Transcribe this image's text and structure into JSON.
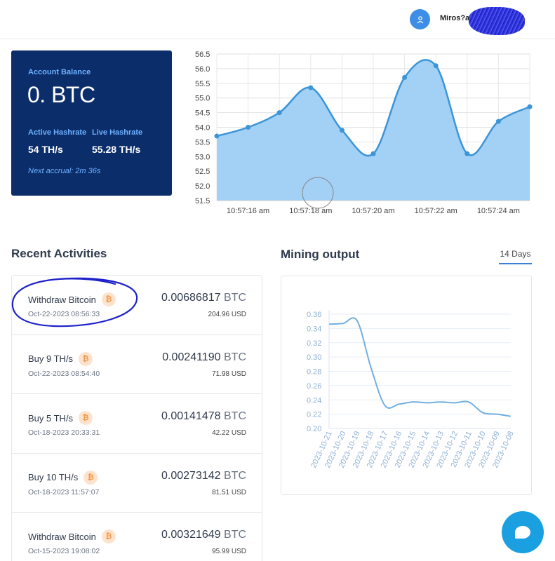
{
  "header": {
    "username": "Miros?a",
    "caret": "⌄"
  },
  "balance": {
    "label": "Account Balance",
    "amount": "0. BTC",
    "active_label": "Active Hashrate",
    "live_label": "Live Hashrate",
    "active_value": "54 TH/s",
    "live_value": "55.28 TH/s",
    "accrual": "Next accrual: 2m 36s"
  },
  "sections": {
    "recent_title": "Recent Activities",
    "mining_title": "Mining output",
    "tab_label": "14 Days"
  },
  "activities": [
    {
      "title": "Withdraw Bitcoin",
      "date": "Oct-22-2023 08:56:33",
      "amount": "0.00686817",
      "currency": "BTC",
      "usd": "204.96 USD"
    },
    {
      "title": "Buy 9 TH/s",
      "date": "Oct-22-2023 08:54:40",
      "amount": "0.00241190",
      "currency": "BTC",
      "usd": "71.98 USD"
    },
    {
      "title": "Buy 5 TH/s",
      "date": "Oct-18-2023 20:33:31",
      "amount": "0.00141478",
      "currency": "BTC",
      "usd": "42.22 USD"
    },
    {
      "title": "Buy 10 TH/s",
      "date": "Oct-18-2023 11:57:07",
      "amount": "0.00273142",
      "currency": "BTC",
      "usd": "81.51 USD"
    },
    {
      "title": "Withdraw Bitcoin",
      "date": "Oct-15-2023 19:08:02",
      "amount": "0.00321649",
      "currency": "BTC",
      "usd": "95.99 USD"
    }
  ],
  "btc_glyph": "₿",
  "colors": {
    "card_bg": "#0b2e6b",
    "accent": "#3d8ee6",
    "chart_fill": "#a3d0f5",
    "chart_line": "#3b95d8",
    "annotation": "#1e22c8"
  },
  "chart_data": [
    {
      "type": "area",
      "x": [
        "10:57:15 am",
        "10:57:16 am",
        "10:57:17 am",
        "10:57:18 am",
        "10:57:19 am",
        "10:57:20 am",
        "10:57:21 am",
        "10:57:22 am",
        "10:57:23 am",
        "10:57:24 am",
        "10:57:25 am"
      ],
      "values": [
        53.7,
        54.0,
        54.5,
        55.35,
        53.9,
        53.1,
        55.7,
        56.1,
        53.1,
        54.2,
        54.7
      ],
      "ylim": [
        51.5,
        56.5
      ],
      "yticks": [
        "51.5",
        "52.0",
        "52.5",
        "53.0",
        "53.5",
        "54.0",
        "54.5",
        "55.0",
        "55.5",
        "56.0",
        "56.5"
      ],
      "xtick_labels": [
        "10:57:16 am",
        "10:57:18 am",
        "10:57:20 am",
        "10:57:22 am",
        "10:57:24 am"
      ],
      "grid": true
    },
    {
      "type": "line",
      "x": [
        "2023-10-21",
        "2023-10-20",
        "2023-10-19",
        "2023-10-18",
        "2023-10-17",
        "2023-10-16",
        "2023-10-15",
        "2023-10-14",
        "2023-10-13",
        "2023-10-12",
        "2023-10-11",
        "2023-10-10",
        "2023-10-09",
        "2023-10-08"
      ],
      "values": [
        0.346,
        0.347,
        0.351,
        0.285,
        0.232,
        0.234,
        0.237,
        0.236,
        0.237,
        0.236,
        0.237,
        0.222,
        0.22,
        0.217
      ],
      "ylim": [
        0.2,
        0.36
      ],
      "yticks": [
        "0.20",
        "0.22",
        "0.24",
        "0.26",
        "0.28",
        "0.30",
        "0.32",
        "0.34",
        "0.36"
      ],
      "grid": true
    }
  ]
}
